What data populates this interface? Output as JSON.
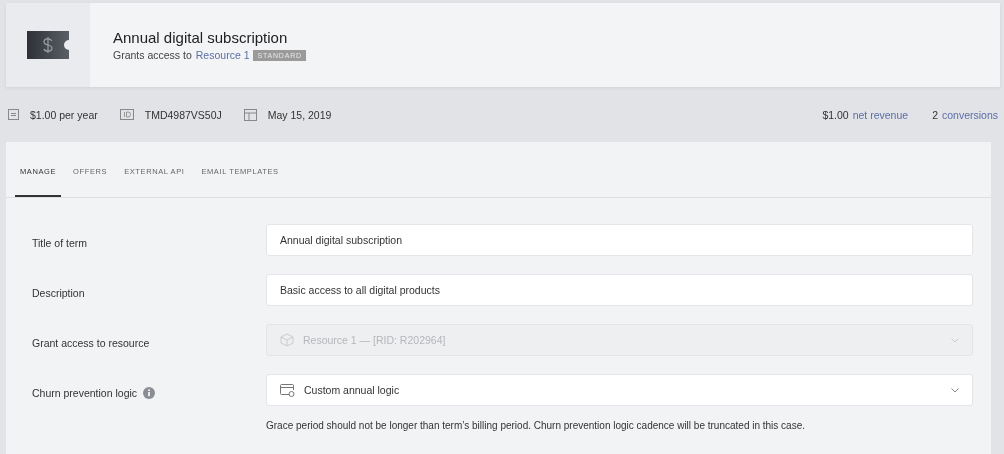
{
  "header": {
    "title": "Annual digital subscription",
    "subtitle": "Grants access to",
    "link": "Resource 1",
    "badge": "STANDARD"
  },
  "stats": [
    {
      "kind": "price",
      "text": "$1.00 per year"
    },
    {
      "kind": "id",
      "text": "TMD4987VS50J"
    },
    {
      "kind": "date",
      "text": "May 15, 2019"
    }
  ],
  "metrics": [
    {
      "value": "$1.00",
      "label": "net revenue"
    },
    {
      "value": "2",
      "label": "conversions"
    }
  ],
  "tabs": [
    {
      "label": "MANAGE",
      "selected": true
    },
    {
      "label": "OFFERS",
      "selected": false
    },
    {
      "label": "EXTERNAL API",
      "selected": false
    },
    {
      "label": "EMAIL TEMPLATES",
      "selected": false
    }
  ],
  "fields": [
    {
      "label": "Title of term",
      "kind": "text",
      "value": "Annual digital subscription",
      "disabled": false,
      "info": false
    },
    {
      "label": "Description",
      "kind": "text",
      "value": "Basic access to all digital products",
      "disabled": false,
      "info": false
    },
    {
      "label": "Grant access to resource",
      "kind": "resource-select",
      "value": "Resource 1 — [RID: R202964]",
      "disabled": true,
      "info": false
    },
    {
      "label": "Churn prevention logic",
      "kind": "logic-select",
      "value": "Custom annual logic",
      "disabled": false,
      "info": true
    }
  ],
  "hint": "Grace period should not be longer than term’s billing period. Churn prevention logic cadence will be truncated in this case."
}
